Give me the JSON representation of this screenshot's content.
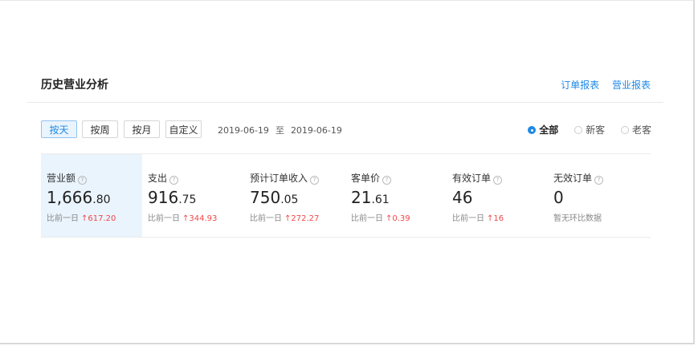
{
  "header": {
    "title": "历史营业分析",
    "links": [
      "订单报表",
      "营业报表"
    ]
  },
  "toolbar": {
    "periods": [
      {
        "label": "按天",
        "active": true
      },
      {
        "label": "按周",
        "active": false
      },
      {
        "label": "按月",
        "active": false
      },
      {
        "label": "自定义",
        "active": false
      }
    ],
    "date_start": "2019-06-19",
    "date_sep": "至",
    "date_end": "2019-06-19",
    "customer_filter": [
      {
        "label": "全部",
        "checked": true
      },
      {
        "label": "新客",
        "checked": false
      },
      {
        "label": "老客",
        "checked": false
      }
    ]
  },
  "stats": [
    {
      "label": "营业额",
      "int": "1,666",
      "dec": ".80",
      "compare_label": "比前一日",
      "change": "↑617.20",
      "active": true
    },
    {
      "label": "支出",
      "int": "916",
      "dec": ".75",
      "compare_label": "比前一日",
      "change": "↑344.93",
      "active": false
    },
    {
      "label": "预计订单收入",
      "int": "750",
      "dec": ".05",
      "compare_label": "比前一日",
      "change": "↑272.27",
      "active": false
    },
    {
      "label": "客单价",
      "int": "21",
      "dec": ".61",
      "compare_label": "比前一日",
      "change": "↑0.39",
      "active": false
    },
    {
      "label": "有效订单",
      "int": "46",
      "dec": "",
      "compare_label": "比前一日",
      "change": "↑16",
      "active": false
    },
    {
      "label": "无效订单",
      "int": "0",
      "dec": "",
      "compare_label": "暂无环比数据",
      "change": "",
      "active": false
    }
  ],
  "icons": {
    "help": "help-circle-icon",
    "change_up_color": "#f04848",
    "accent_color": "#1e88e5"
  }
}
